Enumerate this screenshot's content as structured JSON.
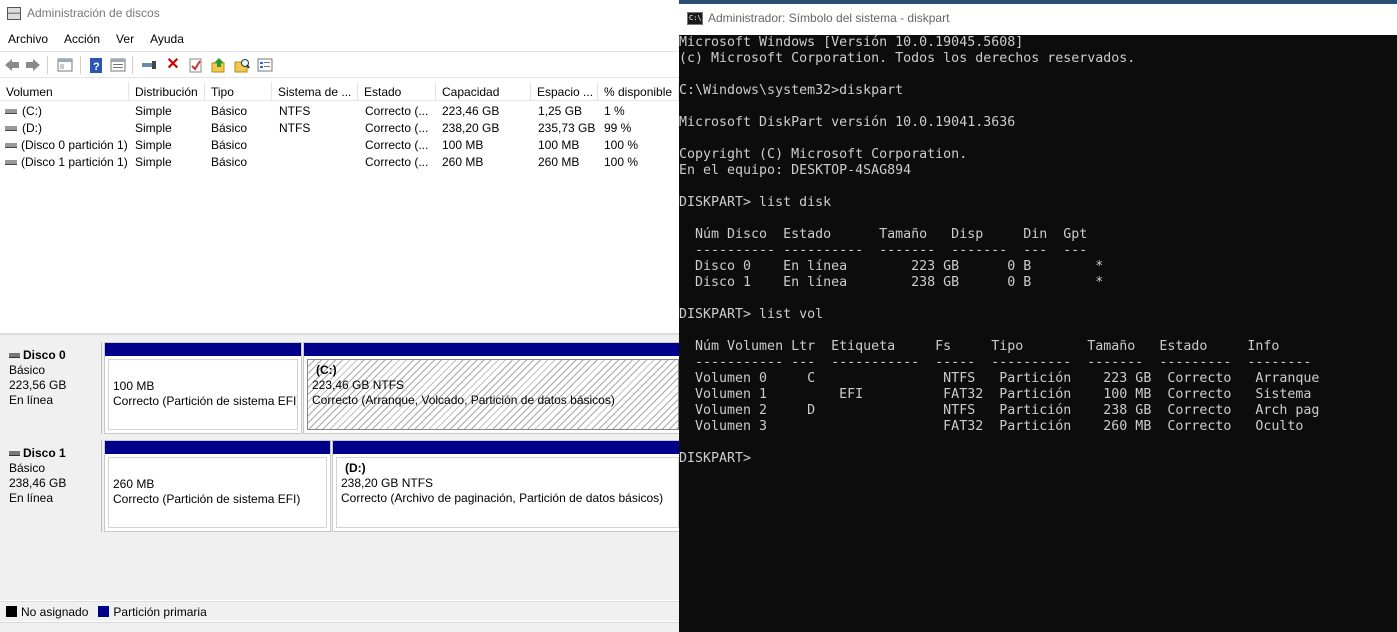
{
  "disk_mgmt": {
    "title": "Administración de discos",
    "menu": [
      "Archivo",
      "Acción",
      "Ver",
      "Ayuda"
    ],
    "toolbar_icons": [
      "back-icon",
      "forward-icon",
      "up-icon",
      "help-icon",
      "properties-icon",
      "connect-icon",
      "delete-icon",
      "check-icon",
      "import-icon",
      "search-icon",
      "list-icon"
    ],
    "columns": [
      "Volumen",
      "Distribución",
      "Tipo",
      "Sistema de ...",
      "Estado",
      "Capacidad",
      "Espacio ...",
      "% disponible"
    ],
    "volumes": [
      [
        "(C:)",
        "Simple",
        "Básico",
        "NTFS",
        "Correcto (...",
        "223,46 GB",
        "1,25 GB",
        "1 %"
      ],
      [
        "(D:)",
        "Simple",
        "Básico",
        "NTFS",
        "Correcto (...",
        "238,20 GB",
        "235,73 GB",
        "99 %"
      ],
      [
        "(Disco 0 partición 1)",
        "Simple",
        "Básico",
        "",
        "Correcto (...",
        "100 MB",
        "100 MB",
        "100 %"
      ],
      [
        "(Disco 1 partición 1)",
        "Simple",
        "Básico",
        "",
        "Correcto (...",
        "260 MB",
        "260 MB",
        "100 %"
      ]
    ],
    "disks": [
      {
        "name": "Disco 0",
        "type": "Básico",
        "size": "223,56 GB",
        "status": "En línea",
        "partitions": [
          {
            "label": "",
            "size": "100 MB",
            "status": "Correcto (Partición de sistema EFI)"
          },
          {
            "label": "(C:)",
            "size": "223,46 GB NTFS",
            "status": "Correcto (Arranque, Volcado, Partición de datos básicos)"
          }
        ]
      },
      {
        "name": "Disco 1",
        "type": "Básico",
        "size": "238,46 GB",
        "status": "En línea",
        "partitions": [
          {
            "label": "",
            "size": "260 MB",
            "status": "Correcto (Partición de sistema EFI)"
          },
          {
            "label": "(D:)",
            "size": "238,20 GB NTFS",
            "status": "Correcto (Archivo de paginación, Partición de datos básicos)"
          }
        ]
      }
    ],
    "legend": [
      {
        "label": "No asignado",
        "color": "#000000"
      },
      {
        "label": "Partición primaria",
        "color": "#00008b"
      }
    ]
  },
  "console": {
    "title": "Administrador: Símbolo del sistema - diskpart",
    "icon_text": "C:\\",
    "lines": [
      "Microsoft Windows [Versión 10.0.19045.5608]",
      "(c) Microsoft Corporation. Todos los derechos reservados.",
      "",
      "C:\\Windows\\system32>diskpart",
      "",
      "Microsoft DiskPart versión 10.0.19041.3636",
      "",
      "Copyright (C) Microsoft Corporation.",
      "En el equipo: DESKTOP-4SAG894",
      "",
      "DISKPART> list disk",
      "",
      "  Núm Disco  Estado      Tamaño   Disp     Din  Gpt",
      "  ---------- ----------  -------  -------  ---  ---",
      "  Disco 0    En línea        223 GB      0 B        *",
      "  Disco 1    En línea        238 GB      0 B        *",
      "",
      "DISKPART> list vol",
      "",
      "  Núm Volumen Ltr  Etiqueta     Fs     Tipo        Tamaño   Estado     Info",
      "  ----------- ---  -----------  -----  ----------  -------  ---------  --------",
      "  Volumen 0     C                NTFS   Partición    223 GB  Correcto   Arranque",
      "  Volumen 1         EFI          FAT32  Partición    100 MB  Correcto   Sistema",
      "  Volumen 2     D                NTFS   Partición    238 GB  Correcto   Arch pag",
      "  Volumen 3                      FAT32  Partición    260 MB  Correcto   Oculto",
      "",
      "DISKPART>"
    ]
  }
}
